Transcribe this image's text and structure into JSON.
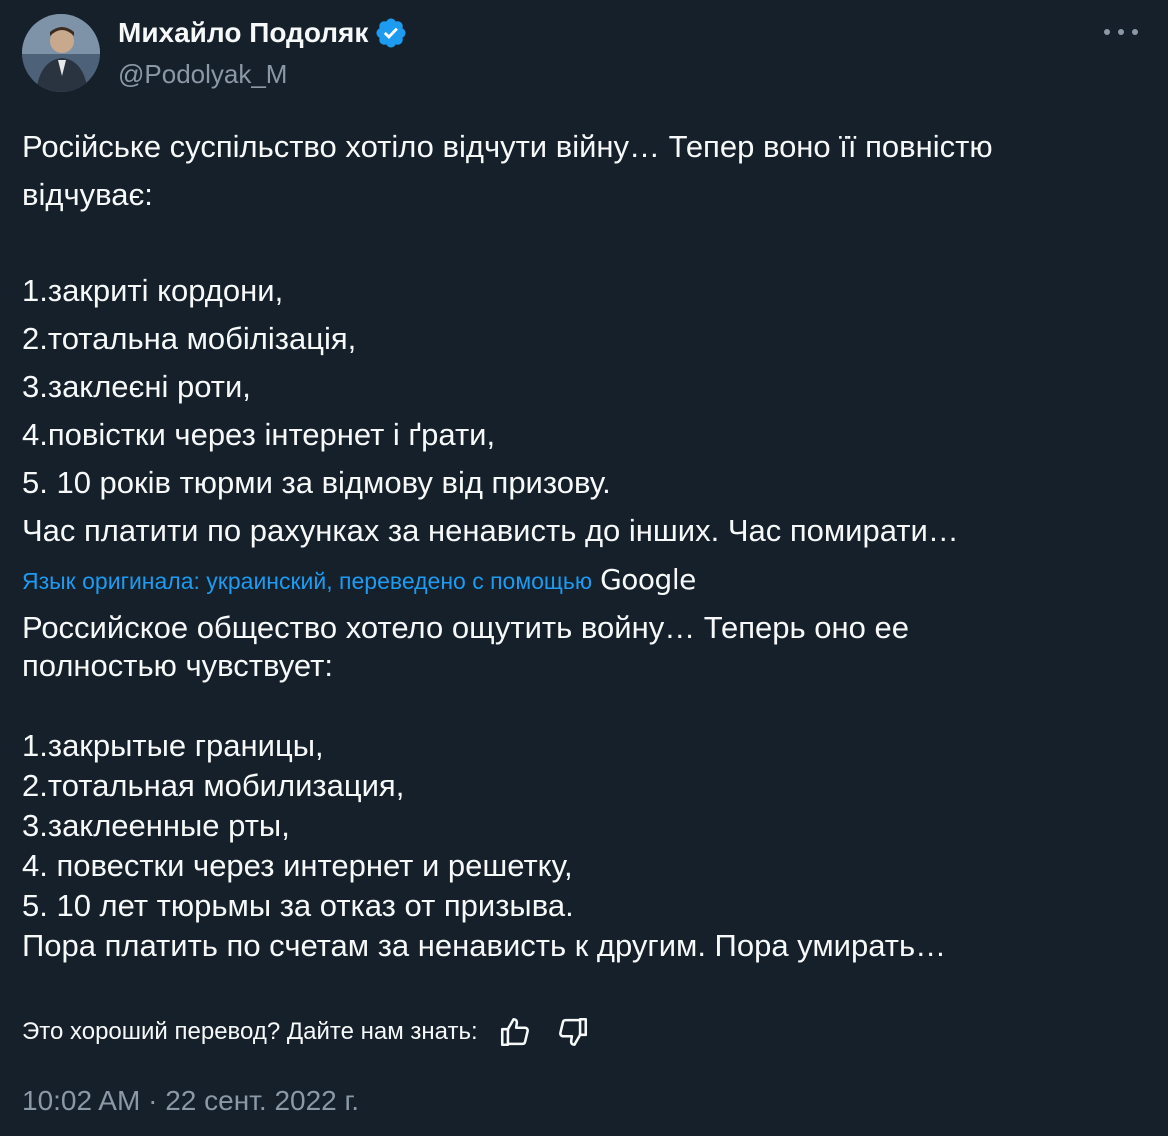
{
  "author": {
    "display_name": "Михайло Подоляк",
    "handle": "@Podolyak_M",
    "verified_color": "#1d9bf0"
  },
  "tweet": {
    "original_lines": [
      "Російське суспільство хотіло відчути війну… Тепер воно її повністю",
      "відчуває:",
      "",
      "1.закриті кордони,",
      "2.тотальна мобілізація,",
      "3.заклеєні роти,",
      "4.повістки через інтернет і ґрати,",
      "5. 10 років тюрми за відмову від призову.",
      "Час платити по рахунках за ненависть до інших. Час помирати…"
    ],
    "translation_note": "Язык оригинала: украинский, переведено с помощью",
    "translation_service": "Google",
    "translated_lines": [
      "Российское общество хотело ощутить войну… Теперь оно ее",
      "полностью чувствует:",
      "",
      "1.закрытые границы,",
      "2.тотальная мобилизация,",
      "3.заклеенные рты,",
      "4. повестки через интернет и решетку,",
      "5. 10 лет тюрьмы за отказ от призыва.",
      "Пора платить по счетам за ненависть к другим. Пора умирать…"
    ]
  },
  "feedback": {
    "prompt": "Это хороший перевод? Дайте нам знать:"
  },
  "meta": {
    "time": "10:02 AM",
    "separator": "·",
    "date": "22 сент. 2022 г."
  },
  "colors": {
    "background": "#15202b",
    "text": "#f7f9f9",
    "secondary": "#8b98a5",
    "accent": "#1d9bf0"
  }
}
